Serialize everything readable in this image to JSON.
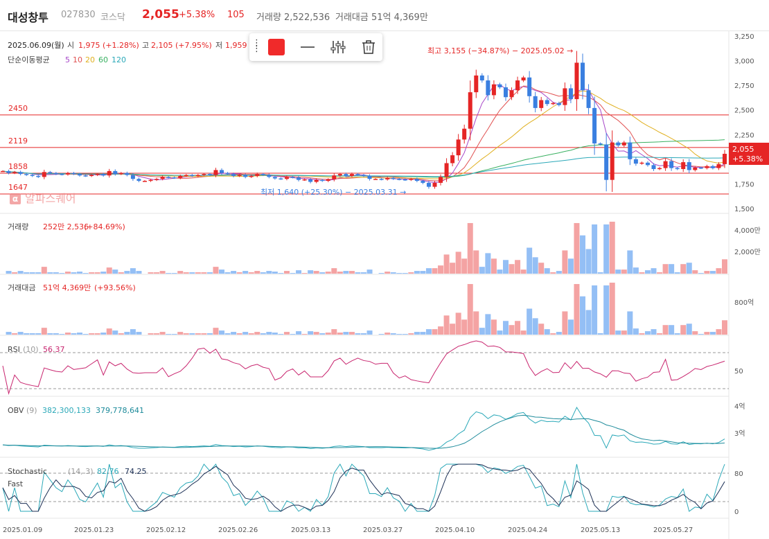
{
  "header": {
    "name": "대성창투",
    "code": "027830",
    "market": "코스닥",
    "price": "2,055",
    "rate": "+5.38%",
    "change": "105",
    "volume": "거래량 2,522,536",
    "amount": "거래대금 51억 4,369만"
  },
  "info": {
    "date": "2025.06.09(월)",
    "open_label": "시",
    "open": "1,975 (+1.28%)",
    "high_label": "고",
    "high": "2,105 (+7.95%)",
    "low_label": "저",
    "low": "1,959",
    "ma_label": "단순이동평균",
    "ma_periods": [
      "5",
      "10",
      "20",
      "60",
      "120"
    ],
    "ma_colors": [
      "#a646c8",
      "#e05050",
      "#e0b020",
      "#38b060",
      "#2aa8b8"
    ]
  },
  "annotations": {
    "high": "최고 3,155 (−34.87%) − 2025.05.02 →",
    "low": "최저 1,640 (+25.30%) − 2025.03.31 →",
    "hlines": [
      {
        "label": "2450",
        "value": 2450
      },
      {
        "label": "2119",
        "value": 2119
      },
      {
        "label": "1858",
        "value": 1858
      },
      {
        "label": "1647",
        "value": 1647
      }
    ],
    "current_price": "2,055",
    "current_rate": "+5.38%"
  },
  "watermark": "알파스퀘어",
  "panels": {
    "volume": {
      "title": "거래량",
      "value": "252만 2,536",
      "rate": "(+84.69%)",
      "ticks": [
        "4,000만",
        "2,000만"
      ]
    },
    "amount": {
      "title": "거래대금",
      "value": "51억 4,369만",
      "rate": "(+93.56%)",
      "ticks": [
        "800억"
      ]
    },
    "rsi": {
      "title": "RSI",
      "param": "(10)",
      "value": "56.37",
      "ticks": [
        "50"
      ]
    },
    "obv": {
      "title": "OBV",
      "param": "(9)",
      "v1": "382,300,133",
      "v2": "379,778,641",
      "ticks": [
        "4억",
        "3억"
      ]
    },
    "stoch": {
      "title": "Stochastic",
      "sub": "Fast",
      "param": "(14, 3)",
      "k": "82.76",
      "d": "74.25",
      "ticks": [
        "80",
        "0"
      ]
    }
  },
  "price_ticks": [
    "3,250",
    "3,000",
    "2,750",
    "2,500",
    "2,250",
    "2,000",
    "1,750",
    "1,500"
  ],
  "x_ticks": [
    "2025.01.09",
    "2025.01.23",
    "2025.02.12",
    "2025.02.26",
    "2025.03.13",
    "2025.03.27",
    "2025.04.10",
    "2025.04.24",
    "2025.05.13",
    "2025.05.27"
  ],
  "colors": {
    "up": "#e52525",
    "down": "#3a7fe0",
    "vol_up": "#f4a3a3",
    "vol_down": "#94bff5",
    "rsi": "#c8246e",
    "obv": "#2aa8b8",
    "obv_sig": "#1c8a9a",
    "stoch_k": "#2aa8b8",
    "stoch_d": "#1b2f55"
  },
  "chart_data": {
    "type": "candlestick",
    "close": [
      1880,
      1860,
      1870,
      1850,
      1840,
      1830,
      1820,
      1870,
      1860,
      1850,
      1845,
      1860,
      1850,
      1835,
      1830,
      1840,
      1850,
      1835,
      1880,
      1850,
      1860,
      1840,
      1800,
      1780,
      1780,
      1790,
      1800,
      1820,
      1815,
      1810,
      1830,
      1840,
      1830,
      1840,
      1850,
      1840,
      1890,
      1860,
      1850,
      1830,
      1840,
      1820,
      1830,
      1850,
      1840,
      1820,
      1805,
      1800,
      1820,
      1815,
      1790,
      1795,
      1770,
      1790,
      1780,
      1795,
      1835,
      1850,
      1830,
      1850,
      1840,
      1830,
      1800,
      1800,
      1795,
      1810,
      1800,
      1795,
      1790,
      1800,
      1780,
      1760,
      1720,
      1760,
      1820,
      1960,
      2040,
      2200,
      2310,
      2680,
      2850,
      2800,
      2650,
      2760,
      2730,
      2630,
      2700,
      2800,
      2830,
      2640,
      2520,
      2600,
      2560,
      2570,
      2550,
      2720,
      2610,
      2980,
      2700,
      2520,
      2160,
      2150,
      1790,
      2170,
      2140,
      2170,
      2000,
      1955,
      1965,
      1940,
      1900,
      1910,
      1980,
      1910,
      1900,
      1970,
      1890,
      1915,
      1910,
      1930,
      1910,
      1950,
      2055
    ],
    "volume_rate": "+84.69%",
    "ma_periods": [
      5,
      10,
      20,
      60,
      120
    ],
    "rsi_period": 10,
    "rsi_last": 56.37,
    "obv_last": 382300133,
    "obv_signal_last": 379778641,
    "stoch_k_last": 82.76,
    "stoch_d_last": 74.25,
    "price_range": [
      1450,
      3300
    ],
    "xlabel": "",
    "ylabel": ""
  }
}
